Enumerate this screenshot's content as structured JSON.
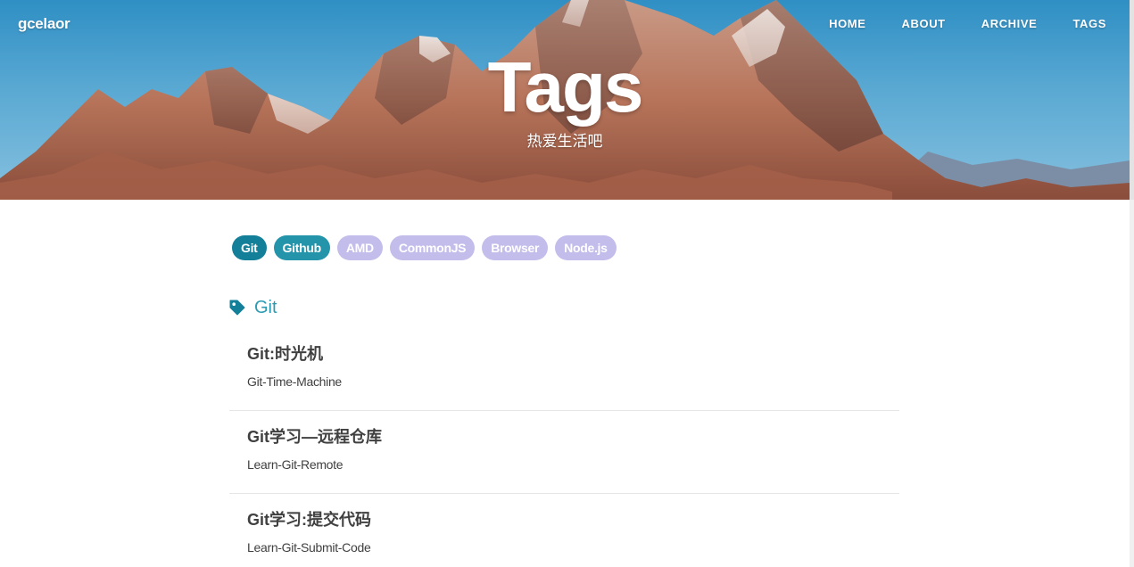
{
  "header": {
    "brand": "gcelaor",
    "nav": [
      "HOME",
      "ABOUT",
      "ARCHIVE",
      "TAGS"
    ],
    "title": "Tags",
    "subtitle": "热爱生活吧"
  },
  "tags": [
    {
      "label": "Git",
      "color": "#137f99"
    },
    {
      "label": "Github",
      "color": "#2494ab"
    },
    {
      "label": "AMD",
      "color": "#c3bdeb"
    },
    {
      "label": "CommonJS",
      "color": "#c3bdeb"
    },
    {
      "label": "Browser",
      "color": "#c3bdeb"
    },
    {
      "label": "Node.js",
      "color": "#c3bdeb"
    }
  ],
  "section": {
    "icon": "tag-icon",
    "title": "Git",
    "accent_color": "#2a9bb3",
    "posts": [
      {
        "title": "Git:时光机",
        "subtitle": "Git-Time-Machine"
      },
      {
        "title": "Git学习—远程仓库",
        "subtitle": "Learn-Git-Remote"
      },
      {
        "title": "Git学习:提交代码",
        "subtitle": "Learn-Git-Submit-Code"
      }
    ]
  }
}
